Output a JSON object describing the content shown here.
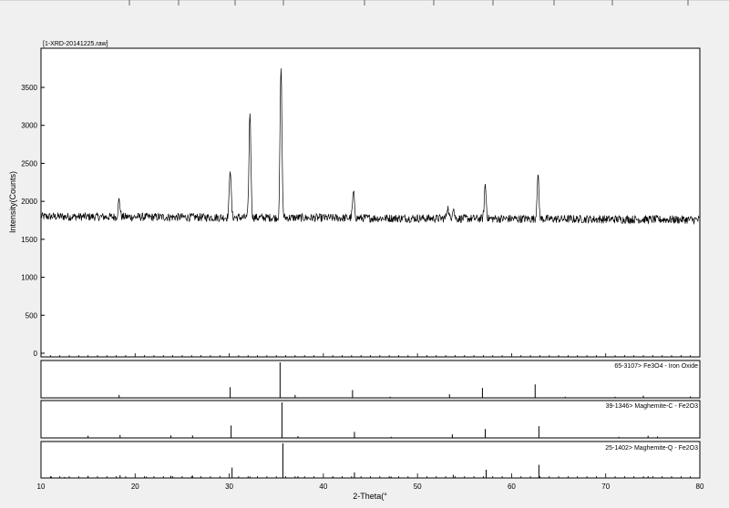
{
  "chart_data": {
    "type": "line",
    "file_label": "[1-XRD-20141225.raw]",
    "xlabel": "2-Theta(°",
    "ylabel": "Intensity(Counts)",
    "xlim": [
      10,
      80
    ],
    "ylim": [
      0,
      3800
    ],
    "x_ticks": [
      10,
      20,
      30,
      40,
      50,
      60,
      70,
      80
    ],
    "y_ticks": [
      0,
      500,
      1000,
      1500,
      2000,
      2500,
      3000,
      3500
    ],
    "baseline_counts": 1800,
    "noise_amplitude_counts": 55,
    "peaks": [
      {
        "two_theta": 18.3,
        "intensity": 2020
      },
      {
        "two_theta": 30.1,
        "intensity": 2440
      },
      {
        "two_theta": 32.2,
        "intensity": 3180
      },
      {
        "two_theta": 35.5,
        "intensity": 3760
      },
      {
        "two_theta": 43.2,
        "intensity": 2120
      },
      {
        "two_theta": 53.2,
        "intensity": 1930
      },
      {
        "two_theta": 53.8,
        "intensity": 1920
      },
      {
        "two_theta": 57.2,
        "intensity": 2220
      },
      {
        "two_theta": 62.8,
        "intensity": 2340
      }
    ],
    "reference_patterns": [
      {
        "label": "65-3107> Fe3O4 - Iron Oxide",
        "lines": [
          {
            "two_theta": 18.3,
            "rel": 0.08
          },
          {
            "two_theta": 30.1,
            "rel": 0.3
          },
          {
            "two_theta": 35.4,
            "rel": 1.0
          },
          {
            "two_theta": 37.0,
            "rel": 0.08
          },
          {
            "two_theta": 43.1,
            "rel": 0.22
          },
          {
            "two_theta": 47.1,
            "rel": 0.03
          },
          {
            "two_theta": 53.4,
            "rel": 0.1
          },
          {
            "two_theta": 56.9,
            "rel": 0.28
          },
          {
            "two_theta": 62.5,
            "rel": 0.38
          },
          {
            "two_theta": 65.7,
            "rel": 0.03
          },
          {
            "two_theta": 71.0,
            "rel": 0.03
          },
          {
            "two_theta": 74.0,
            "rel": 0.06
          },
          {
            "two_theta": 79.0,
            "rel": 0.04
          }
        ]
      },
      {
        "label": "39-1346> Maghemite-C - Fe2O3",
        "lines": [
          {
            "two_theta": 15.0,
            "rel": 0.06
          },
          {
            "two_theta": 18.4,
            "rel": 0.08
          },
          {
            "two_theta": 23.8,
            "rel": 0.07
          },
          {
            "two_theta": 26.1,
            "rel": 0.07
          },
          {
            "two_theta": 30.2,
            "rel": 0.35
          },
          {
            "two_theta": 35.6,
            "rel": 1.0
          },
          {
            "two_theta": 37.3,
            "rel": 0.05
          },
          {
            "two_theta": 43.3,
            "rel": 0.17
          },
          {
            "two_theta": 47.2,
            "rel": 0.03
          },
          {
            "two_theta": 53.7,
            "rel": 0.1
          },
          {
            "two_theta": 57.2,
            "rel": 0.25
          },
          {
            "two_theta": 62.9,
            "rel": 0.33
          },
          {
            "two_theta": 71.4,
            "rel": 0.03
          },
          {
            "two_theta": 74.5,
            "rel": 0.06
          },
          {
            "two_theta": 75.5,
            "rel": 0.04
          }
        ]
      },
      {
        "label": "25-1402> Maghemite-Q - Fe2O3",
        "lines": [
          {
            "two_theta": 11.1,
            "rel": 0.04
          },
          {
            "two_theta": 12.5,
            "rel": 0.03
          },
          {
            "two_theta": 15.0,
            "rel": 0.06
          },
          {
            "two_theta": 18.4,
            "rel": 0.08
          },
          {
            "two_theta": 21.2,
            "rel": 0.04
          },
          {
            "two_theta": 23.8,
            "rel": 0.06
          },
          {
            "two_theta": 26.1,
            "rel": 0.07
          },
          {
            "two_theta": 30.3,
            "rel": 0.3
          },
          {
            "two_theta": 32.2,
            "rel": 0.04
          },
          {
            "two_theta": 35.7,
            "rel": 1.0
          },
          {
            "two_theta": 37.3,
            "rel": 0.05
          },
          {
            "two_theta": 41.0,
            "rel": 0.03
          },
          {
            "two_theta": 43.3,
            "rel": 0.16
          },
          {
            "two_theta": 47.2,
            "rel": 0.04
          },
          {
            "two_theta": 53.8,
            "rel": 0.09
          },
          {
            "two_theta": 57.3,
            "rel": 0.24
          },
          {
            "two_theta": 62.9,
            "rel": 0.38
          },
          {
            "two_theta": 74.5,
            "rel": 0.05
          }
        ]
      }
    ],
    "grid": false
  }
}
